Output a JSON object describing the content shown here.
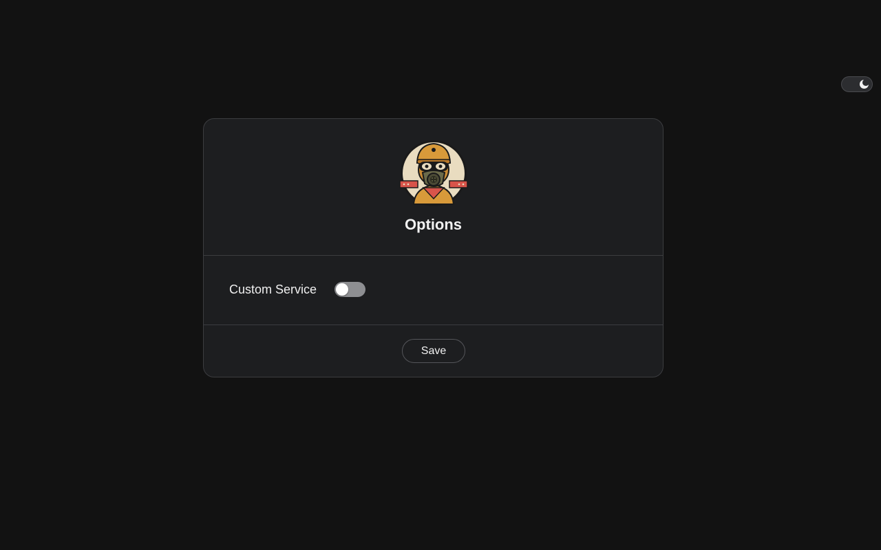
{
  "theme_toggle": {
    "icon": "moon-icon",
    "mode": "dark"
  },
  "options": {
    "logo": "gas-mask-mascot-logo",
    "title": "Options",
    "custom_service": {
      "label": "Custom Service",
      "enabled": false
    },
    "save_label": "Save"
  },
  "colors": {
    "background": "#121212",
    "card": "#1d1e20",
    "border": "#3c3d40",
    "text": "#f2f2f2",
    "switch_off": "#8e8f92",
    "logo_orange": "#d89a3a",
    "logo_red": "#d8544a"
  }
}
